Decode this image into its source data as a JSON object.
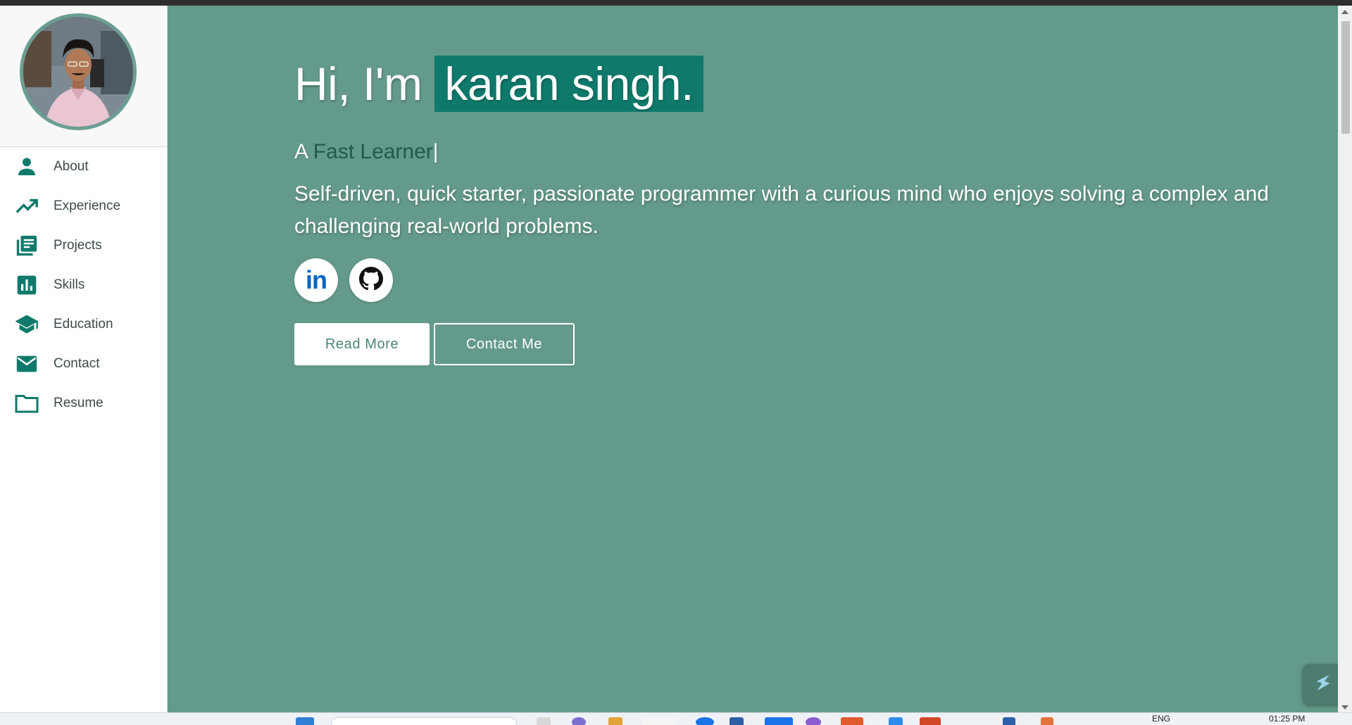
{
  "profile": {
    "avatar_alt": "karan singh profile photo"
  },
  "sidebar": {
    "items": [
      {
        "label": "About",
        "icon": "person-icon"
      },
      {
        "label": "Experience",
        "icon": "trending-up-icon"
      },
      {
        "label": "Projects",
        "icon": "library-books-icon"
      },
      {
        "label": "Skills",
        "icon": "bar-chart-icon"
      },
      {
        "label": "Education",
        "icon": "school-icon"
      },
      {
        "label": "Contact",
        "icon": "mail-icon"
      },
      {
        "label": "Resume",
        "icon": "folder-icon"
      }
    ]
  },
  "hero": {
    "greeting": "Hi, I'm",
    "name": "karan singh.",
    "subtitle_prefix": "A",
    "role": "Fast Learner",
    "cursor": "|",
    "description": "Self-driven, quick starter, passionate programmer with a curious mind who enjoys solving a complex and challenging real-world problems.",
    "socials": [
      {
        "name": "linkedin-icon",
        "text": "in"
      },
      {
        "name": "github-icon"
      }
    ],
    "read_more_label": "Read More",
    "contact_label": "Contact Me"
  },
  "taskbar": {
    "lang": "ENG",
    "time": "01:25 PM"
  },
  "colors": {
    "main_bg": "#649a8b",
    "accent": "#0f7a6b",
    "icon": "#0f7a6b",
    "sidebar_text": "#3d4b4b"
  }
}
